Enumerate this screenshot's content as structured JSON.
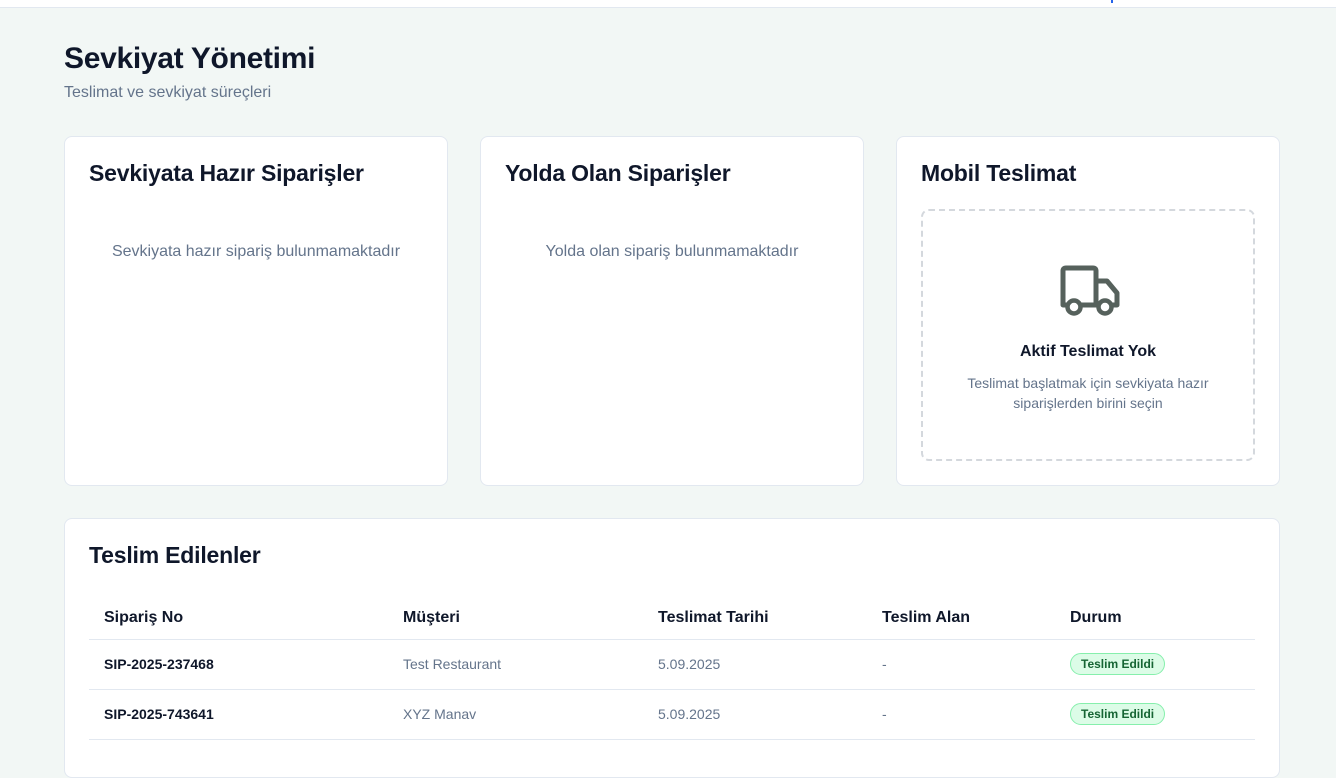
{
  "page": {
    "title": "Sevkiyat Yönetimi",
    "subtitle": "Teslimat ve sevkiyat süreçleri"
  },
  "ready": {
    "title": "Sevkiyata Hazır Siparişler",
    "empty": "Sevkiyata hazır sipariş bulunmamaktadır"
  },
  "transit": {
    "title": "Yolda Olan Siparişler",
    "empty": "Yolda olan sipariş bulunmamaktadır"
  },
  "mobile": {
    "title": "Mobil Teslimat",
    "icon": "truck-icon",
    "empty_title": "Aktif Teslimat Yok",
    "empty_text": "Teslimat başlatmak için sevkiyata hazır siparişlerden birini seçin"
  },
  "delivered": {
    "title": "Teslim Edilenler",
    "columns": [
      "Sipariş No",
      "Müşteri",
      "Teslimat Tarihi",
      "Teslim Alan",
      "Durum"
    ],
    "rows": [
      [
        "SIP-2025-237468",
        "Test Restaurant",
        "5.09.2025",
        "-",
        "Teslim Edildi"
      ],
      [
        "SIP-2025-743641",
        "XYZ Manav",
        "5.09.2025",
        "-",
        "Teslim Edildi"
      ]
    ]
  },
  "colors": {
    "background": "#f2f7f5",
    "badge_bg": "#dcfce7",
    "badge_text": "#166534"
  }
}
